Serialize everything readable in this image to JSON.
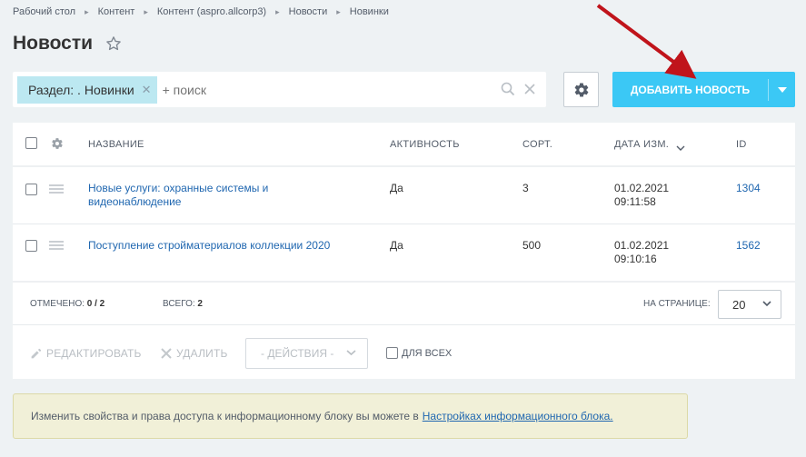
{
  "breadcrumb": [
    "Рабочий стол",
    "Контент",
    "Контент (aspro.allcorp3)",
    "Новости",
    "Новинки"
  ],
  "page": {
    "title": "Новости"
  },
  "filter": {
    "tag_label": "Раздел: . Новинки",
    "placeholder": "+ поиск"
  },
  "toolbar": {
    "add_label": "ДОБАВИТЬ НОВОСТЬ",
    "accent": "#3bc8f5"
  },
  "grid": {
    "columns": [
      "НАЗВАНИЕ",
      "АКТИВНОСТЬ",
      "СОРТ.",
      "ДАТА ИЗМ.",
      "ID"
    ],
    "rows": [
      {
        "name_line1": "Новые услуги: охранные системы и",
        "name_line2": "видеонаблюдение",
        "active": "Да",
        "sort": "3",
        "date": "01.02.2021",
        "time": "09:11:58",
        "id": "1304"
      },
      {
        "name_line1": "Поступление стройматериалов коллекции 2020",
        "name_line2": "",
        "active": "Да",
        "sort": "500",
        "date": "01.02.2021",
        "time": "09:10:16",
        "id": "1562"
      }
    ],
    "footer": {
      "checked_label": "ОТМЕЧЕНО:",
      "checked_value": "0 / 2",
      "total_label": "ВСЕГО:",
      "total_value": "2",
      "per_page_label": "НА СТРАНИЦЕ:",
      "per_page_value": "20"
    },
    "actions": {
      "edit_label": "РЕДАКТИРОВАТЬ",
      "delete_label": "УДАЛИТЬ",
      "select_label": "- ДЕЙСТВИЯ -",
      "for_all_label": "ДЛЯ ВСЕХ"
    }
  },
  "notice": {
    "text": "Изменить свойства и права доступа к информационному блоку вы можете в",
    "link": "Настройках информационного блока."
  }
}
